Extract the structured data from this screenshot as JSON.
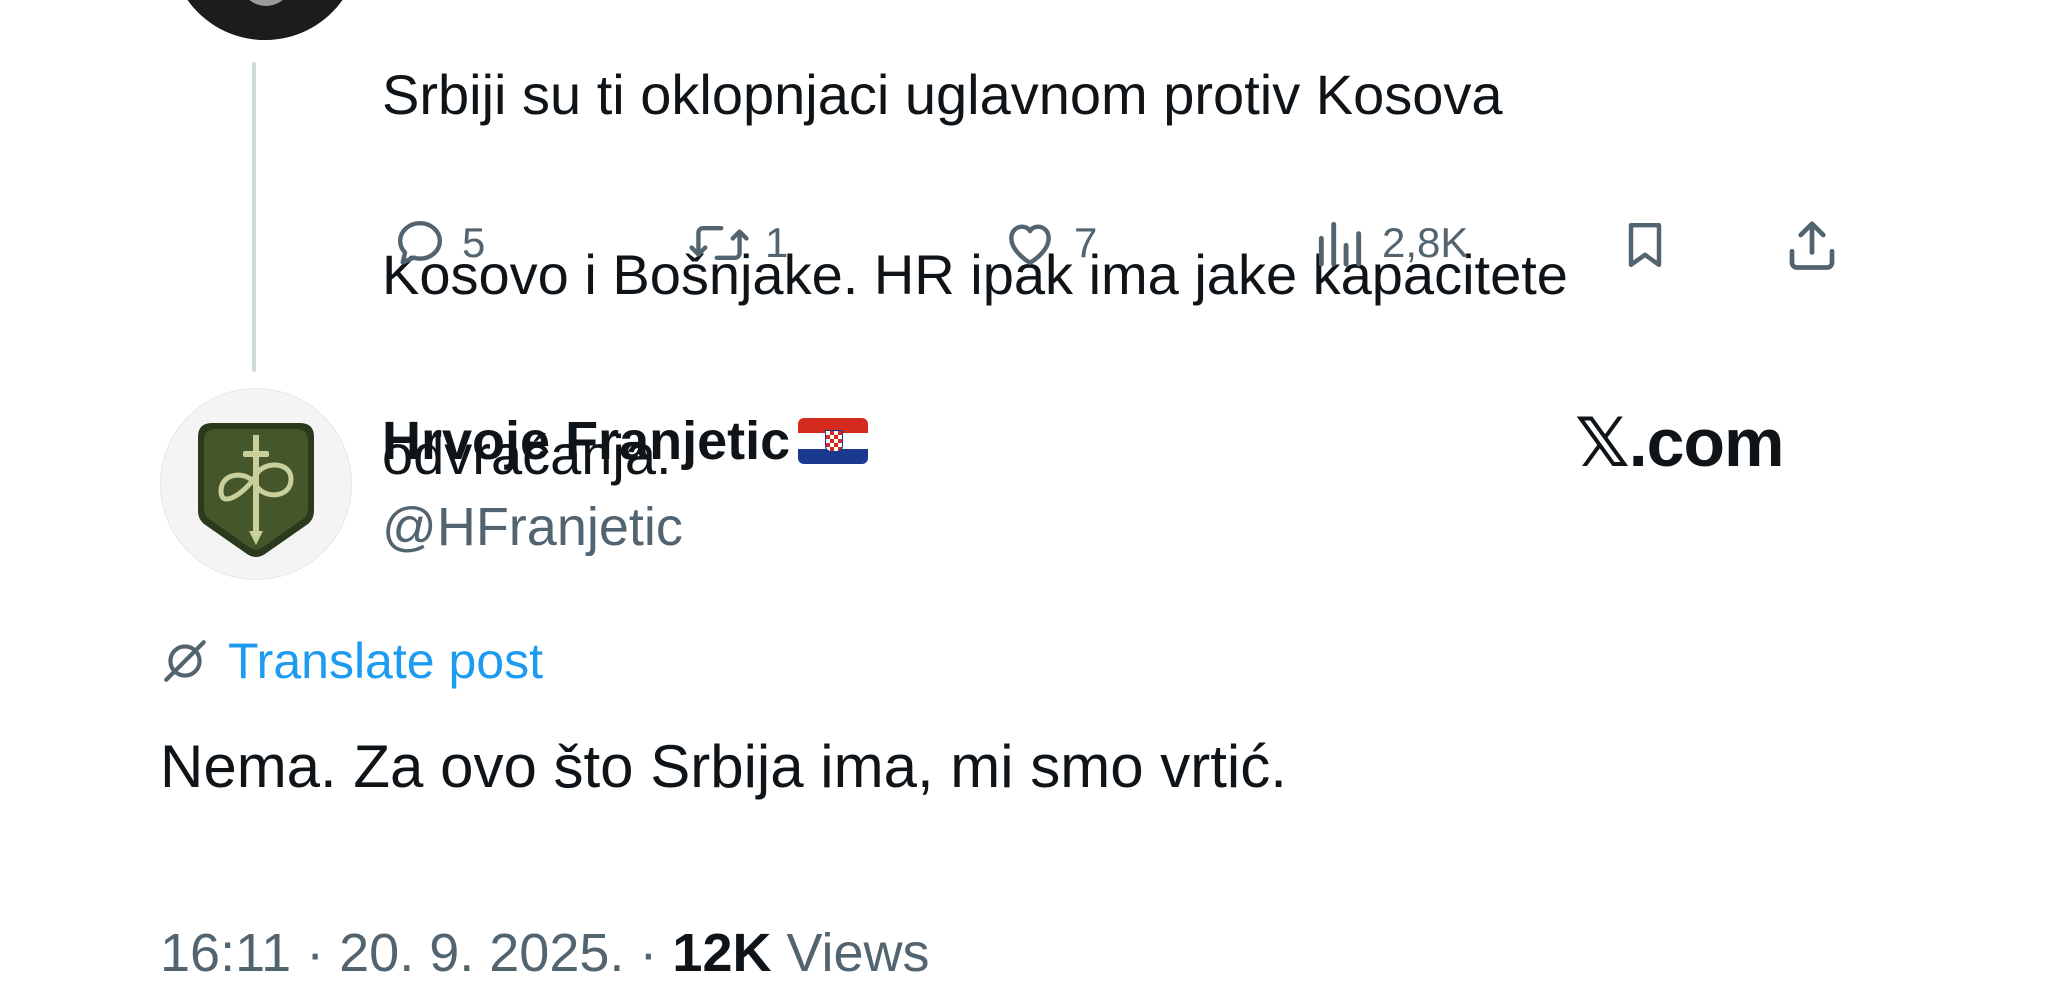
{
  "parent_tweet": {
    "text_lines": [
      "Srbiji su ti oklopnjaci uglavnom protiv Kosova",
      "Kosovo i Bošnjake. HR ipak ima jake kapacitete",
      "odvraćanja."
    ],
    "actions": {
      "replies": "5",
      "reposts": "1",
      "likes": "7",
      "views": "2,8K"
    },
    "icons": {
      "reply": "reply-bubble-icon",
      "repost": "repost-icon",
      "like": "heart-icon",
      "views": "views-bar-chart-icon",
      "bookmark": "bookmark-icon",
      "share": "share-upload-icon"
    }
  },
  "reply_tweet": {
    "display_name": "Hrvoje Franjetic",
    "name_emoji": "croatian-flag-icon",
    "handle": "@HFranjetic",
    "translate_label": "Translate post",
    "text": "Nema. Za ovo što Srbija ima, mi smo vrtić.",
    "time": "16:11",
    "separator": "·",
    "date": "20. 9. 2025.",
    "views_count": "12K",
    "views_label": "Views"
  },
  "watermark": "𝕏.com",
  "colors": {
    "text_primary": "#0f1419",
    "text_secondary": "#536471",
    "link_blue": "#1d9bf0",
    "thread_line": "#cfd9de",
    "flag_red": "#d52b1e",
    "flag_blue": "#1a3a8f"
  }
}
